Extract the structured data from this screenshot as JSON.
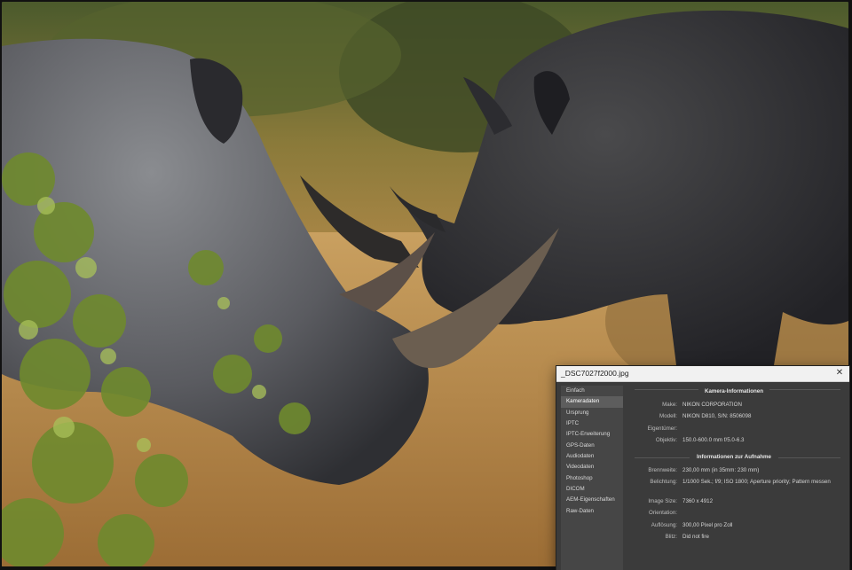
{
  "photo": {
    "alt_icon": "rhino-photo"
  },
  "dialog": {
    "title": "_DSC7027f2000.jpg",
    "close_icon": "✕",
    "sidebar": {
      "items": [
        {
          "label": "Einfach"
        },
        {
          "label": "Kameradaten"
        },
        {
          "label": "Ursprung"
        },
        {
          "label": "IPTC"
        },
        {
          "label": "IPTC-Erweiterung"
        },
        {
          "label": "GPS-Daten"
        },
        {
          "label": "Audiodaten"
        },
        {
          "label": "Videodaten"
        },
        {
          "label": "Photoshop"
        },
        {
          "label": "DICOM"
        },
        {
          "label": "AEM-Eigenschaften"
        },
        {
          "label": "Raw-Daten"
        }
      ],
      "active_index": 1
    },
    "camera_section": {
      "title": "Kamera-Informationen",
      "rows": [
        {
          "label": "Make:",
          "value": "NIKON CORPORATION"
        },
        {
          "label": "Modell:",
          "value": "NIKON D810,   S/N: 8506098"
        },
        {
          "label": "Eigentümer:",
          "value": ""
        },
        {
          "label": "Objektiv:",
          "value": "150.0-600.0 mm f/5.0-6.3"
        }
      ]
    },
    "capture_section": {
      "title": "Informationen zur Aufnahme",
      "rows": [
        {
          "label": "Brennweite:",
          "value": "230,00 mm   (in 35mm: 230 mm)"
        },
        {
          "label": "Belichtung:",
          "value": "1/1000 Sek.;   f/9;   ISO 1800;   Aperture priority;   Pattern messen"
        },
        {
          "label": "Image Size:",
          "value": "7360 x 4912"
        },
        {
          "label": "Orientation:",
          "value": ""
        },
        {
          "label": "Auflösung:",
          "value": "300,00 Pixel pro Zoll"
        },
        {
          "label": "Blitz:",
          "value": "Did not fire"
        }
      ]
    }
  },
  "colors": {
    "dialog_bg": "#3b3b3b",
    "sidebar_bg": "#464646",
    "active_item": "#5d5d5d",
    "titlebar": "#f1f1f1"
  }
}
